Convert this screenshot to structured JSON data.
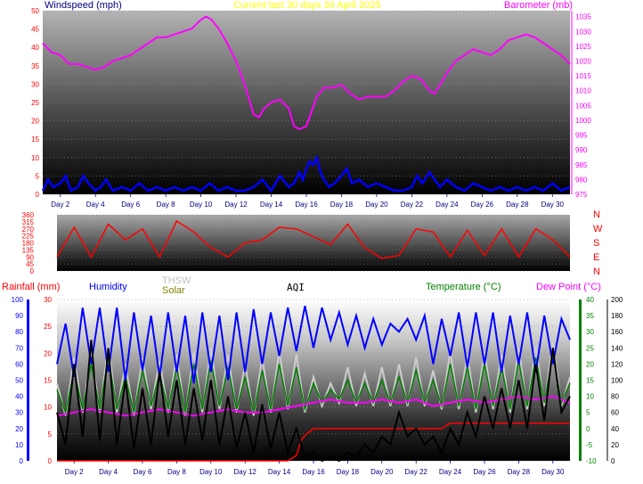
{
  "header": {
    "title": "Current last 30 days 30 April 2025",
    "wind_label": "Windspeed (mph)",
    "baro_label": "Barometer (mb)"
  },
  "colors": {
    "wind": "#0000ff",
    "baro": "#ff00ff",
    "dir": "#ff0000",
    "title": "#ffff00",
    "humidity": "#0000ff",
    "temperature": "#008000",
    "dewpoint": "#ff00ff",
    "aqi": "#000000",
    "thsw": "#cccccc",
    "solar": "#808000",
    "rain": "#ff0000"
  },
  "bottom_labels": {
    "rainfall": "Rainfall (mm)",
    "humidity": "Humidity",
    "thsw": "THSW",
    "solar": "Solar",
    "aqi": "AQI",
    "temperature": "Temperature (°C)",
    "dewpoint": "Dew Point (°C)"
  },
  "compass_labels": [
    "N",
    "W",
    "S",
    "E",
    "N"
  ],
  "chart_data": [
    {
      "type": "line",
      "x_tick_labels": [
        "Day 2",
        "Day 4",
        "Day 6",
        "Day 8",
        "Day 10",
        "Day 12",
        "Day 14",
        "Day 16",
        "Day 18",
        "Day 20",
        "Day 22",
        "Day 24",
        "Day 26",
        "Day 28",
        "Day 30"
      ],
      "xlim": [
        1,
        31
      ],
      "title": "Current last 30 days 30 April 2025",
      "ylabel": "Windspeed (mph)",
      "ylabel_right": "Barometer (mb)",
      "ylim": [
        0,
        50
      ],
      "ylim_right": [
        975,
        1037
      ],
      "y_ticks": [
        0,
        5,
        10,
        15,
        20,
        25,
        30,
        35,
        40,
        45,
        50
      ],
      "y_ticks_right": [
        975,
        980,
        985,
        990,
        995,
        1000,
        1005,
        1010,
        1015,
        1020,
        1025,
        1030,
        1035
      ],
      "series": [
        {
          "axis": "right",
          "x": [
            1,
            1.5,
            2,
            2.5,
            3,
            3.5,
            4,
            4.5,
            5,
            5.5,
            6,
            6.5,
            7,
            7.5,
            8,
            8.5,
            9,
            9.5,
            10,
            10.3,
            10.6,
            11,
            11.5,
            12,
            12.5,
            13,
            13.3,
            13.6,
            14,
            14.5,
            15,
            15.3,
            15.6,
            16,
            16.3,
            16.6,
            17,
            17.5,
            18,
            18.5,
            19,
            19.5,
            20,
            20.5,
            21,
            21.5,
            22,
            22.5,
            23,
            23.3,
            23.6,
            24,
            24.5,
            25,
            25.5,
            26,
            26.5,
            27,
            27.5,
            28,
            28.5,
            29,
            29.5,
            30,
            30.5,
            31
          ],
          "values": [
            1026,
            1023,
            1022,
            1019,
            1019,
            1018,
            1017,
            1018,
            1020,
            1021,
            1022,
            1024,
            1026,
            1028,
            1028,
            1029,
            1030,
            1031,
            1034,
            1035,
            1034,
            1031,
            1026,
            1020,
            1012,
            1002,
            1001,
            1004,
            1006,
            1007,
            1004,
            998,
            997,
            998,
            1003,
            1008,
            1011,
            1011,
            1012,
            1009,
            1007,
            1008,
            1008,
            1008,
            1010,
            1013,
            1015,
            1014,
            1010,
            1009,
            1012,
            1016,
            1020,
            1022,
            1024,
            1023,
            1022,
            1024,
            1027,
            1028,
            1029,
            1028,
            1026,
            1024,
            1022,
            1019
          ]
        },
        {
          "axis": "left",
          "x": [
            1,
            1.3,
            1.6,
            2,
            2.3,
            2.6,
            3,
            3.3,
            3.6,
            4,
            4.3,
            4.6,
            5,
            5.5,
            6,
            6.5,
            7,
            7.5,
            8,
            8.5,
            9,
            9.5,
            10,
            10.5,
            11,
            11.5,
            12,
            12.5,
            13,
            13.5,
            14,
            14.5,
            15,
            15.3,
            15.6,
            15.8,
            16,
            16.2,
            16.4,
            16.6,
            16.8,
            17,
            17.3,
            17.6,
            18,
            18.3,
            18.6,
            19,
            19.5,
            20,
            20.5,
            21,
            21.5,
            22,
            22.3,
            22.6,
            23,
            23.3,
            23.6,
            24,
            24.5,
            25,
            25.5,
            26,
            26.5,
            27,
            27.5,
            28,
            28.5,
            29,
            29.5,
            30,
            30.5,
            31
          ],
          "values": [
            1,
            4,
            2,
            3,
            5,
            1,
            2,
            5,
            3,
            1,
            2,
            4,
            1,
            2,
            1,
            3,
            1,
            2,
            1,
            2,
            1,
            2,
            1,
            3,
            1,
            2,
            1,
            1,
            2,
            4,
            1,
            5,
            2,
            3,
            6,
            4,
            7,
            9,
            8,
            10,
            6,
            4,
            2,
            3,
            5,
            7,
            3,
            4,
            2,
            3,
            2,
            1,
            1,
            2,
            5,
            3,
            6,
            4,
            2,
            4,
            2,
            1,
            3,
            2,
            1,
            2,
            1,
            2,
            1,
            2,
            1,
            3,
            1,
            2
          ]
        }
      ]
    },
    {
      "type": "line",
      "x_tick_labels": [
        "Day 2",
        "Day 4",
        "Day 6",
        "Day 8",
        "Day 10",
        "Day 12",
        "Day 14",
        "Day 16",
        "Day 18",
        "Day 20",
        "Day 22",
        "Day 24",
        "Day 26",
        "Day 28",
        "Day 30"
      ],
      "xlim": [
        1,
        31
      ],
      "ylim": [
        0,
        360
      ],
      "y_ticks": [
        0,
        45,
        90,
        135,
        180,
        225,
        270,
        315,
        360
      ],
      "series": [
        {
          "x": [
            1,
            2,
            3,
            4,
            5,
            6,
            7,
            8,
            9,
            10,
            11,
            12,
            13,
            14,
            15,
            16,
            17,
            18,
            19,
            20,
            21,
            22,
            23,
            24,
            25,
            26,
            27,
            28,
            29,
            30,
            31
          ],
          "values": [
            90,
            280,
            90,
            300,
            200,
            270,
            90,
            320,
            250,
            150,
            90,
            180,
            200,
            280,
            270,
            220,
            170,
            300,
            150,
            80,
            100,
            270,
            250,
            90,
            260,
            100,
            270,
            90,
            270,
            200,
            90
          ]
        }
      ]
    },
    {
      "type": "line",
      "x_tick_labels": [
        "Day 2",
        "Day 4",
        "Day 6",
        "Day 8",
        "Day 10",
        "Day 12",
        "Day 14",
        "Day 16",
        "Day 18",
        "Day 20",
        "Day 22",
        "Day 24",
        "Day 26",
        "Day 28",
        "Day 30"
      ],
      "xlim": [
        1,
        31
      ],
      "ylabel": "Rainfall (mm)",
      "ylim": [
        0,
        30
      ],
      "y_ticks": [
        0,
        5,
        10,
        15,
        20,
        25,
        30
      ],
      "y2_ticks": [
        0,
        10,
        20,
        30,
        40,
        50,
        60,
        70,
        80,
        90,
        100
      ],
      "y3_ticks": [
        -10,
        -5,
        0,
        5,
        10,
        15,
        20,
        25,
        30,
        35,
        40
      ],
      "y4_ticks": [
        0,
        20,
        40,
        60,
        80,
        100,
        120,
        140,
        160,
        180,
        200
      ],
      "series": [
        {
          "name": "Rainfall (mm)",
          "x": [
            1,
            14,
            14.5,
            15,
            15.3,
            15.6,
            16,
            17,
            18,
            19,
            20,
            21,
            22,
            23,
            23.5,
            24,
            25,
            26,
            27,
            28,
            29,
            30,
            31
          ],
          "values": [
            0,
            0,
            0,
            1,
            4,
            5,
            6,
            6,
            6,
            6,
            6,
            6,
            6,
            6,
            6,
            7,
            7,
            7,
            7,
            7,
            7,
            7,
            7
          ]
        },
        {
          "name": "Humidity",
          "x": [
            1,
            1.5,
            2,
            2.5,
            3,
            3.5,
            4,
            4.5,
            5,
            5.5,
            6,
            6.5,
            7,
            7.5,
            8,
            8.5,
            9,
            9.5,
            10,
            10.5,
            11,
            11.5,
            12,
            12.5,
            13,
            13.5,
            14,
            14.5,
            15,
            15.5,
            16,
            16.5,
            17,
            17.5,
            18,
            18.5,
            19,
            19.5,
            20,
            20.5,
            21,
            21.5,
            22,
            22.5,
            23,
            23.5,
            24,
            24.5,
            25,
            25.5,
            26,
            26.5,
            27,
            27.5,
            28,
            28.5,
            29,
            29.5,
            30,
            30.5,
            31
          ],
          "values": [
            60,
            85,
            52,
            95,
            60,
            95,
            55,
            95,
            50,
            92,
            56,
            90,
            52,
            92,
            55,
            90,
            48,
            92,
            55,
            90,
            50,
            92,
            55,
            94,
            60,
            92,
            65,
            95,
            68,
            96,
            70,
            95,
            75,
            92,
            72,
            90,
            70,
            88,
            72,
            85,
            80,
            88,
            75,
            90,
            60,
            88,
            65,
            92,
            58,
            92,
            60,
            92,
            55,
            90,
            60,
            92,
            55,
            90,
            60,
            88,
            75
          ]
        },
        {
          "name": "Temperature (°C)",
          "x": [
            1,
            1.5,
            2,
            2.5,
            3,
            3.5,
            4,
            4.5,
            5,
            5.5,
            6,
            6.5,
            7,
            7.5,
            8,
            8.5,
            9,
            9.5,
            10,
            10.5,
            11,
            11.5,
            12,
            12.5,
            13,
            13.5,
            14,
            14.5,
            15,
            15.5,
            16,
            16.5,
            17,
            17.5,
            18,
            18.5,
            19,
            19.5,
            20,
            20.5,
            21,
            21.5,
            22,
            22.5,
            23,
            23.5,
            24,
            24.5,
            25,
            25.5,
            26,
            26.5,
            27,
            27.5,
            28,
            28.5,
            29,
            29.5,
            30,
            30.5,
            31
          ],
          "values": [
            12,
            5,
            18,
            6,
            20,
            6,
            22,
            6,
            16,
            5,
            18,
            7,
            17,
            6,
            19,
            5,
            20,
            6,
            21,
            7,
            19,
            6,
            16,
            5,
            18,
            6,
            20,
            7,
            19,
            6,
            14,
            8,
            12,
            9,
            15,
            8,
            14,
            8,
            15,
            8,
            16,
            8,
            18,
            8,
            15,
            7,
            20,
            7,
            19,
            6,
            20,
            7,
            19,
            6,
            21,
            7,
            22,
            8,
            23,
            8,
            14
          ]
        },
        {
          "name": "THSW",
          "x": [
            1,
            1.5,
            2,
            2.5,
            3,
            3.5,
            4,
            4.5,
            5,
            5.5,
            6,
            6.5,
            7,
            7.5,
            8,
            8.5,
            9,
            9.5,
            10,
            10.5,
            11,
            11.5,
            12,
            12.5,
            13,
            13.5,
            14,
            14.5,
            15,
            15.5,
            16,
            16.5,
            17,
            17.5,
            18,
            18.5,
            19,
            19.5,
            20,
            20.5,
            21,
            21.5,
            22,
            22.5,
            23,
            23.5,
            24,
            24.5,
            25,
            25.5,
            26,
            26.5,
            27,
            27.5,
            28,
            28.5,
            29,
            29.5,
            30,
            30.5,
            31
          ],
          "values": [
            14,
            4,
            22,
            5,
            24,
            5,
            26,
            5,
            20,
            4,
            22,
            6,
            21,
            5,
            23,
            4,
            24,
            5,
            25,
            6,
            23,
            5,
            20,
            4,
            22,
            5,
            24,
            6,
            23,
            5,
            16,
            7,
            14,
            8,
            19,
            7,
            17,
            7,
            19,
            7,
            20,
            7,
            22,
            7,
            18,
            6,
            24,
            6,
            23,
            5,
            24,
            6,
            23,
            5,
            25,
            6,
            26,
            7,
            27,
            7,
            16
          ]
        },
        {
          "name": "Dew Point (°C)",
          "x": [
            1,
            2,
            3,
            4,
            5,
            6,
            7,
            8,
            9,
            10,
            11,
            12,
            13,
            14,
            15,
            16,
            17,
            18,
            19,
            20,
            21,
            22,
            23,
            24,
            25,
            26,
            27,
            28,
            29,
            30,
            31
          ],
          "values": [
            4,
            5,
            6,
            5,
            4,
            5,
            6,
            5,
            4,
            5,
            6,
            5,
            5,
            6,
            7,
            8,
            9,
            8,
            8,
            9,
            8,
            9,
            7,
            8,
            9,
            8,
            9,
            10,
            9,
            10,
            8
          ]
        },
        {
          "name": "AQI",
          "x": [
            1,
            1.5,
            2,
            2.5,
            3,
            3.5,
            4,
            4.5,
            5,
            5.5,
            6,
            6.5,
            7,
            7.5,
            8,
            8.5,
            9,
            9.5,
            10,
            10.5,
            11,
            11.5,
            12,
            12.5,
            13,
            13.5,
            14,
            14.5,
            15,
            15.5,
            16,
            16.5,
            17,
            17.5,
            18,
            18.5,
            19,
            19.5,
            20,
            20.5,
            21,
            21.5,
            22,
            22.5,
            23,
            23.5,
            24,
            24.5,
            25,
            25.5,
            26,
            26.5,
            27,
            27.5,
            28,
            28.5,
            29,
            29.5,
            30,
            30.5,
            31
          ],
          "values": [
            60,
            20,
            120,
            30,
            150,
            25,
            140,
            20,
            100,
            15,
            90,
            20,
            110,
            30,
            100,
            20,
            90,
            25,
            100,
            20,
            80,
            15,
            60,
            10,
            70,
            15,
            60,
            10,
            40,
            5,
            10,
            0,
            5,
            0,
            10,
            5,
            20,
            10,
            30,
            20,
            60,
            30,
            40,
            20,
            30,
            10,
            40,
            20,
            60,
            30,
            80,
            40,
            90,
            40,
            100,
            40,
            120,
            50,
            140,
            60,
            80
          ]
        }
      ]
    }
  ]
}
